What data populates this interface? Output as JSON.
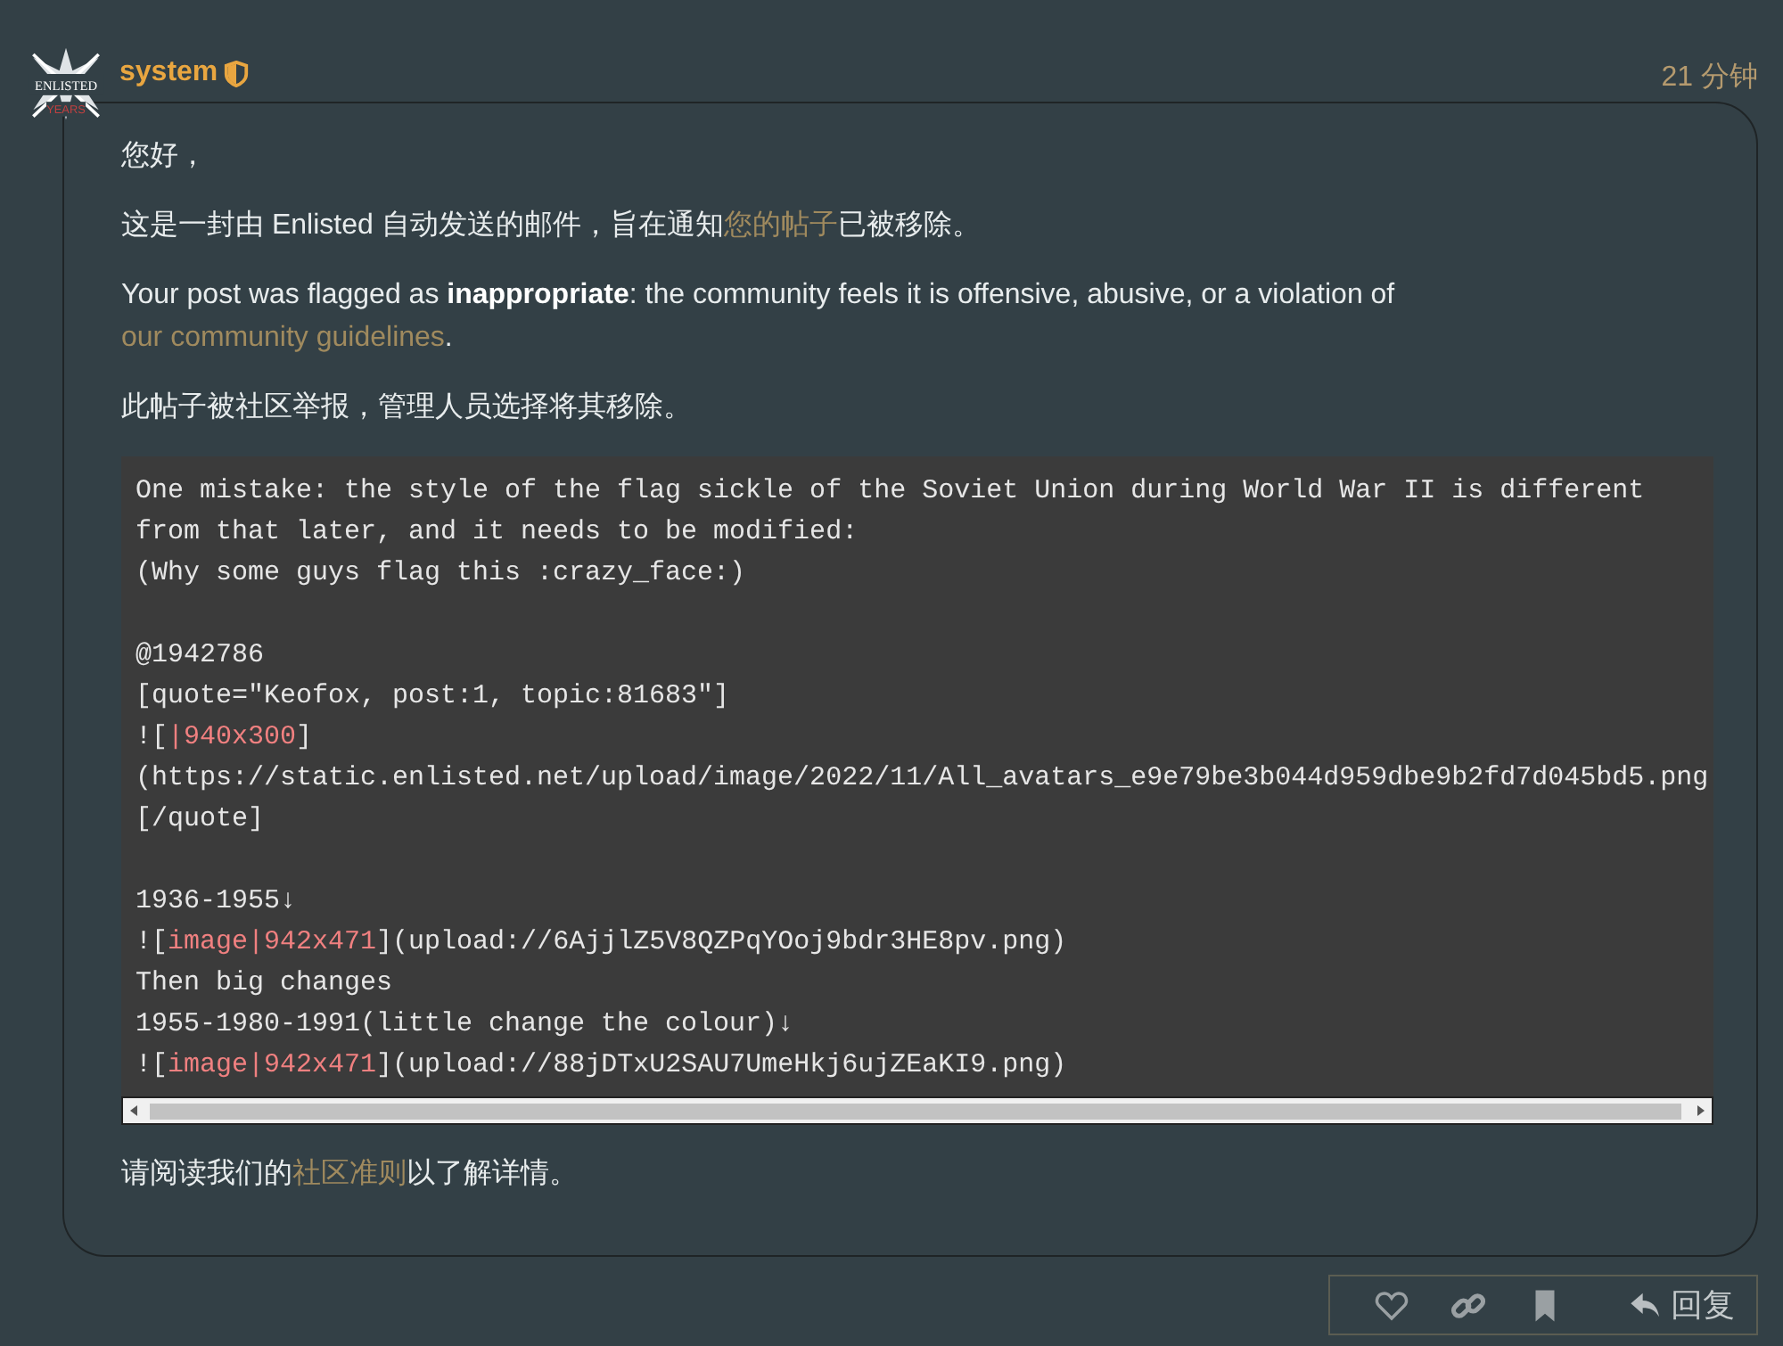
{
  "post": {
    "avatar": {
      "text": "ENLISTED",
      "subtext": "YEARS"
    },
    "username": "system",
    "moderator": true,
    "time": "21 分钟"
  },
  "paragraphs": [
    {
      "parts": [
        {
          "text": "您好，",
          "kind": "plain"
        }
      ]
    },
    {
      "parts": [
        {
          "text": "这是一封由 Enlisted 自动发送的邮件，旨在通知",
          "kind": "plain"
        },
        {
          "text": "您的帖子",
          "kind": "link"
        },
        {
          "text": "已被移除。",
          "kind": "plain"
        }
      ]
    },
    {
      "parts": [
        {
          "text": "Your post was flagged as ",
          "kind": "plain"
        },
        {
          "text": "inappropriate",
          "kind": "bold"
        },
        {
          "text": ": the community feels it is offensive, abusive, or a violation of ",
          "kind": "plain"
        },
        {
          "text": "our community guidelines",
          "kind": "link"
        },
        {
          "text": ".",
          "kind": "plain"
        }
      ]
    },
    {
      "parts": [
        {
          "text": "此帖子被社区举报，管理人员选择将其移除。",
          "kind": "plain"
        }
      ]
    }
  ],
  "code_blocks": [
    [
      {
        "parts": [
          {
            "text": "One mistake: the style of the flag sickle of the Soviet Union during World War II is different",
            "kind": "plain"
          }
        ]
      },
      {
        "parts": [
          {
            "text": "from that later, and it needs to be modified:",
            "kind": "plain"
          }
        ]
      },
      {
        "parts": [
          {
            "text": "(Why some guys flag this :crazy_face:)",
            "kind": "plain"
          }
        ]
      }
    ],
    [
      {
        "parts": [
          {
            "text": "@1942786",
            "kind": "plain"
          }
        ]
      },
      {
        "parts": [
          {
            "text": "[quote=\"Keofox, post:1, topic:81683\"]",
            "kind": "plain"
          }
        ]
      },
      {
        "parts": [
          {
            "text": "![",
            "kind": "plain"
          },
          {
            "text": "|940x300",
            "kind": "tag"
          },
          {
            "text": "]",
            "kind": "plain"
          }
        ]
      },
      {
        "parts": [
          {
            "text": "(https://static.enlisted.net/upload/image/2022/11/All_avatars_e9e79be3b044d959dbe9b2fd7d045bd5.png",
            "kind": "plain"
          }
        ]
      },
      {
        "parts": [
          {
            "text": "[/quote]",
            "kind": "plain"
          }
        ]
      }
    ],
    [
      {
        "parts": [
          {
            "text": "1936-1955↓",
            "kind": "plain"
          }
        ]
      },
      {
        "parts": [
          {
            "text": "![",
            "kind": "plain"
          },
          {
            "text": "image|942x471",
            "kind": "tag"
          },
          {
            "text": "](upload://6AjjlZ5V8QZPqYOoj9bdr3HE8pv.png)",
            "kind": "plain"
          }
        ]
      },
      {
        "parts": [
          {
            "text": "Then big changes",
            "kind": "plain"
          }
        ]
      },
      {
        "parts": [
          {
            "text": "1955-1980-1991(little change the colour)↓",
            "kind": "plain"
          }
        ]
      },
      {
        "parts": [
          {
            "text": "![",
            "kind": "plain"
          },
          {
            "text": "image|942x471",
            "kind": "tag"
          },
          {
            "text": "](upload://88jDTxU2SAU7UmeHkj6ujZEaKI9.png)",
            "kind": "plain"
          }
        ]
      }
    ]
  ],
  "footer_paragraph": {
    "parts": [
      {
        "text": "请阅读我们的",
        "kind": "plain"
      },
      {
        "text": "社区准则",
        "kind": "link"
      },
      {
        "text": "以了解详情。",
        "kind": "plain"
      }
    ]
  },
  "actions": {
    "reply_label": "回复"
  }
}
